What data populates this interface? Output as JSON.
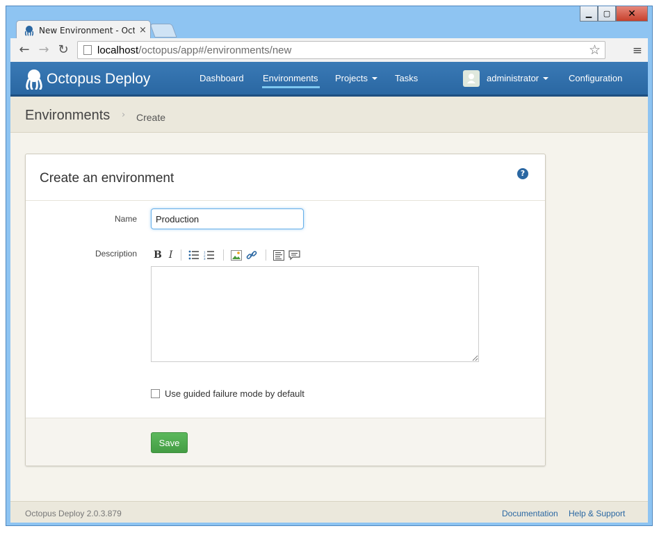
{
  "browser": {
    "tab_title": "New Environment - Octop",
    "tab_close": "×",
    "url_host": "localhost",
    "url_path": "/octopus/app#/environments/new",
    "window_buttons": {
      "minimize": "▁",
      "maximize": "▢",
      "close": "✕"
    },
    "back": "←",
    "forward": "→",
    "reload": "↻",
    "star": "☆",
    "menu": "≡"
  },
  "header": {
    "brand": "Octopus Deploy",
    "nav": {
      "dashboard": "Dashboard",
      "environments": "Environments",
      "projects": "Projects",
      "tasks": "Tasks",
      "user": "administrator",
      "configuration": "Configuration"
    },
    "active": "Environments"
  },
  "breadcrumb": {
    "main": "Environments",
    "sep": "›",
    "sub": "Create"
  },
  "form": {
    "title": "Create an environment",
    "help": "?",
    "name_label": "Name",
    "name_value": "Production",
    "description_label": "Description",
    "description_value": "",
    "toolbar": {
      "bold": "B",
      "italic": "I"
    },
    "checkbox_label": "Use guided failure mode by default",
    "checkbox_checked": false,
    "save_label": "Save"
  },
  "footer": {
    "version": "Octopus Deploy 2.0.3.879",
    "documentation": "Documentation",
    "help_support": "Help & Support"
  },
  "colors": {
    "header_blue": "#2a67a2",
    "save_green": "#5cb85c",
    "page_bg": "#f5f3ec",
    "link": "#2a67a2"
  }
}
